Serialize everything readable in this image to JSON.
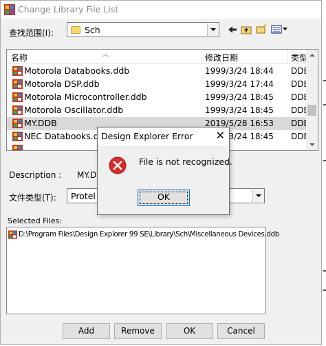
{
  "window": {
    "title": "Change Library File List"
  },
  "lookin": {
    "label": "查找范围(I):",
    "value": "Sch"
  },
  "file_list": {
    "columns": [
      "名称",
      "修改日期",
      "类型"
    ],
    "rows": [
      {
        "name": "Motorola Databooks.ddb",
        "date": "1999/3/24 18:44",
        "type": "DDB"
      },
      {
        "name": "Motorola DSP.ddb",
        "date": "1999/3/24 17:44",
        "type": "DDB"
      },
      {
        "name": "Motorola Microcontroller.ddb",
        "date": "1999/3/24 18:45",
        "type": "DDB"
      },
      {
        "name": "Motorola Oscillator.ddb",
        "date": "1999/3/24 18:45",
        "type": "DDB"
      },
      {
        "name": "MY.DDB",
        "date": "2019/5/28 16:53",
        "type": "DDB",
        "selected": true
      },
      {
        "name": "NEC Databooks.ddb",
        "date": "1999/3/24 18:45",
        "type": "DDB"
      }
    ]
  },
  "description": {
    "label": "Description :",
    "value": "MY.DDB"
  },
  "filetype": {
    "label": "文件类型(T):",
    "value": "Protel D"
  },
  "selected_files": {
    "label": "Selected Files:",
    "items": [
      "D:\\Program Files\\Design Explorer 99 SE\\Library\\Sch\\Miscellaneous Devices.ddb"
    ]
  },
  "buttons": {
    "add": "Add",
    "remove": "Remove",
    "ok": "OK",
    "cancel": "Cancel"
  },
  "error_dialog": {
    "title": "Design Explorer Error",
    "close": "✕",
    "message": "File is not recognized.",
    "ok": "OK"
  },
  "colors": {
    "selected_row": "#d9d9d9",
    "error_red": "#d92b2b",
    "focus_blue": "#0078d7"
  }
}
